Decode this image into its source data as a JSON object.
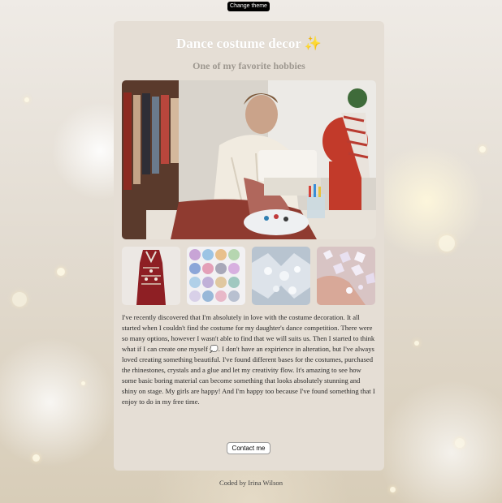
{
  "theme_button": {
    "label": "Change theme"
  },
  "card": {
    "title": "Dance costume decor",
    "title_emoji": "✨",
    "subtitle": "One of my favorite hobbies",
    "hero_image": "sewing-studio-photo",
    "thumbnails": [
      "red-costume-photo",
      "rhinestone-sets-photo",
      "crystal-appliques-photo",
      "hand-with-rhinestones-photo"
    ],
    "body": "I've recently discovered that I'm absolutely in love with the costume decoration. It all started when I couldn't find the costume for my daughter's dance competition. There were so many options, however I wasn't able to find that we will suits us. Then I started to think what if I can create one myself 💭. I don't have an expirience in alteration, but I've always loved creating something beautiful. I've found different bases for the costumes, purchased the rhinestones, crystals and a glue and let my creativity flow. It's amazing to see how some basic boring material can become something that looks absolutely stunning and shiny on stage. My girls are happy! And I'm happy too because I've found something that I enjoy to do in my free time.",
    "contact_button": "Contact me"
  },
  "footer": {
    "text": "Coded by Irina Wilson"
  },
  "colors": {
    "card_bg": "#e5ded5",
    "subtitle": "#9e9890",
    "theme_button_bg": "#000000"
  }
}
